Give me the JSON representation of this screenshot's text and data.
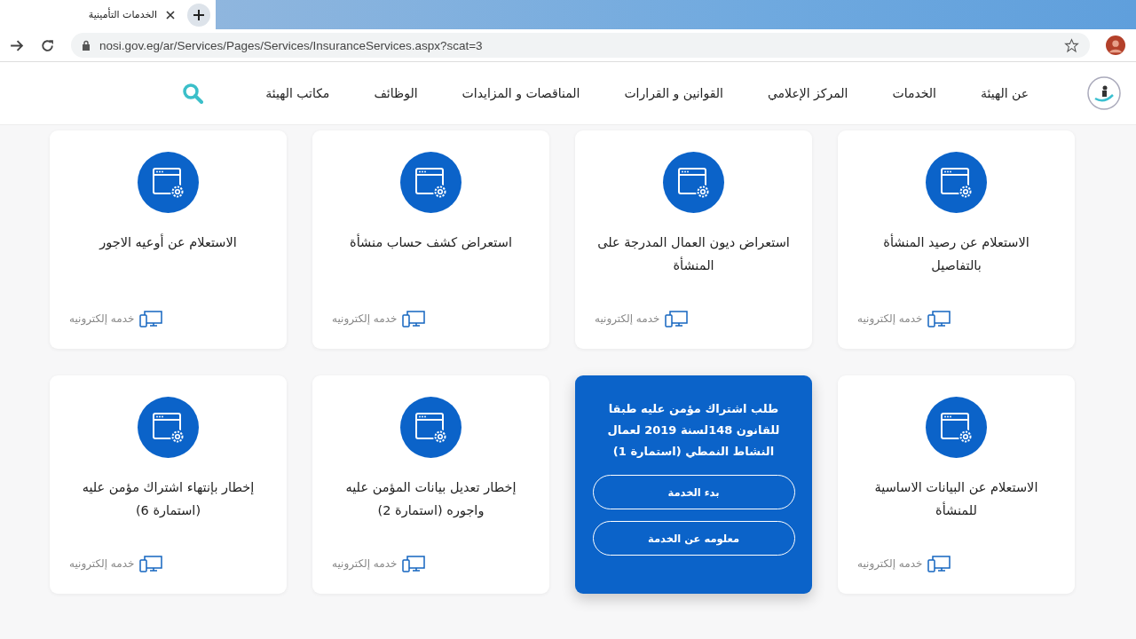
{
  "browser": {
    "tab_title": "الخدمات التأمينية",
    "address": "nosi.gov.eg/ar/Services/Pages/Services/InsuranceServices.aspx?scat=3"
  },
  "nav": {
    "items": [
      {
        "label": "عن الهيئة"
      },
      {
        "label": "الخدمات"
      },
      {
        "label": "المركز الإعلامي"
      },
      {
        "label": "القوانين و القرارات"
      },
      {
        "label": "المناقصات و المزايدات"
      },
      {
        "label": "الوظائف"
      },
      {
        "label": "مكاتب الهيئة"
      }
    ]
  },
  "cards": [
    {
      "kind": "service",
      "title": "الاستعلام عن رصيد المنشأة بالتفاصيل",
      "tag": "خدمه إلكترونيه"
    },
    {
      "kind": "service",
      "title": "استعراض ديون العمال المدرجة على المنشأة",
      "tag": "خدمه إلكترونيه"
    },
    {
      "kind": "service",
      "title": "استعراض كشف حساب منشأة",
      "tag": "خدمه إلكترونيه"
    },
    {
      "kind": "service",
      "title": "الاستعلام عن أوعيه الاجور",
      "tag": "خدمه إلكترونيه"
    },
    {
      "kind": "service",
      "title": "الاستعلام عن البيانات الاساسية للمنشأة",
      "tag": "خدمه إلكترونيه"
    },
    {
      "kind": "hover",
      "title": "طلب اشتراك مؤمن عليه طبقا للقانون 148لسنة 2019 لعمال النشاط النمطي (استمارة 1)",
      "buttons": [
        "بدء الخدمة",
        "معلومه عن الخدمة"
      ]
    },
    {
      "kind": "service",
      "title": "إخطار تعديل بيانات المؤمن عليه واجوره (استمارة 2)",
      "tag": "خدمه إلكترونيه"
    },
    {
      "kind": "service",
      "title": "إخطار بإنتهاء اشتراك مؤمن عليه (استمارة 6)",
      "tag": "خدمه إلكترونيه"
    }
  ]
}
